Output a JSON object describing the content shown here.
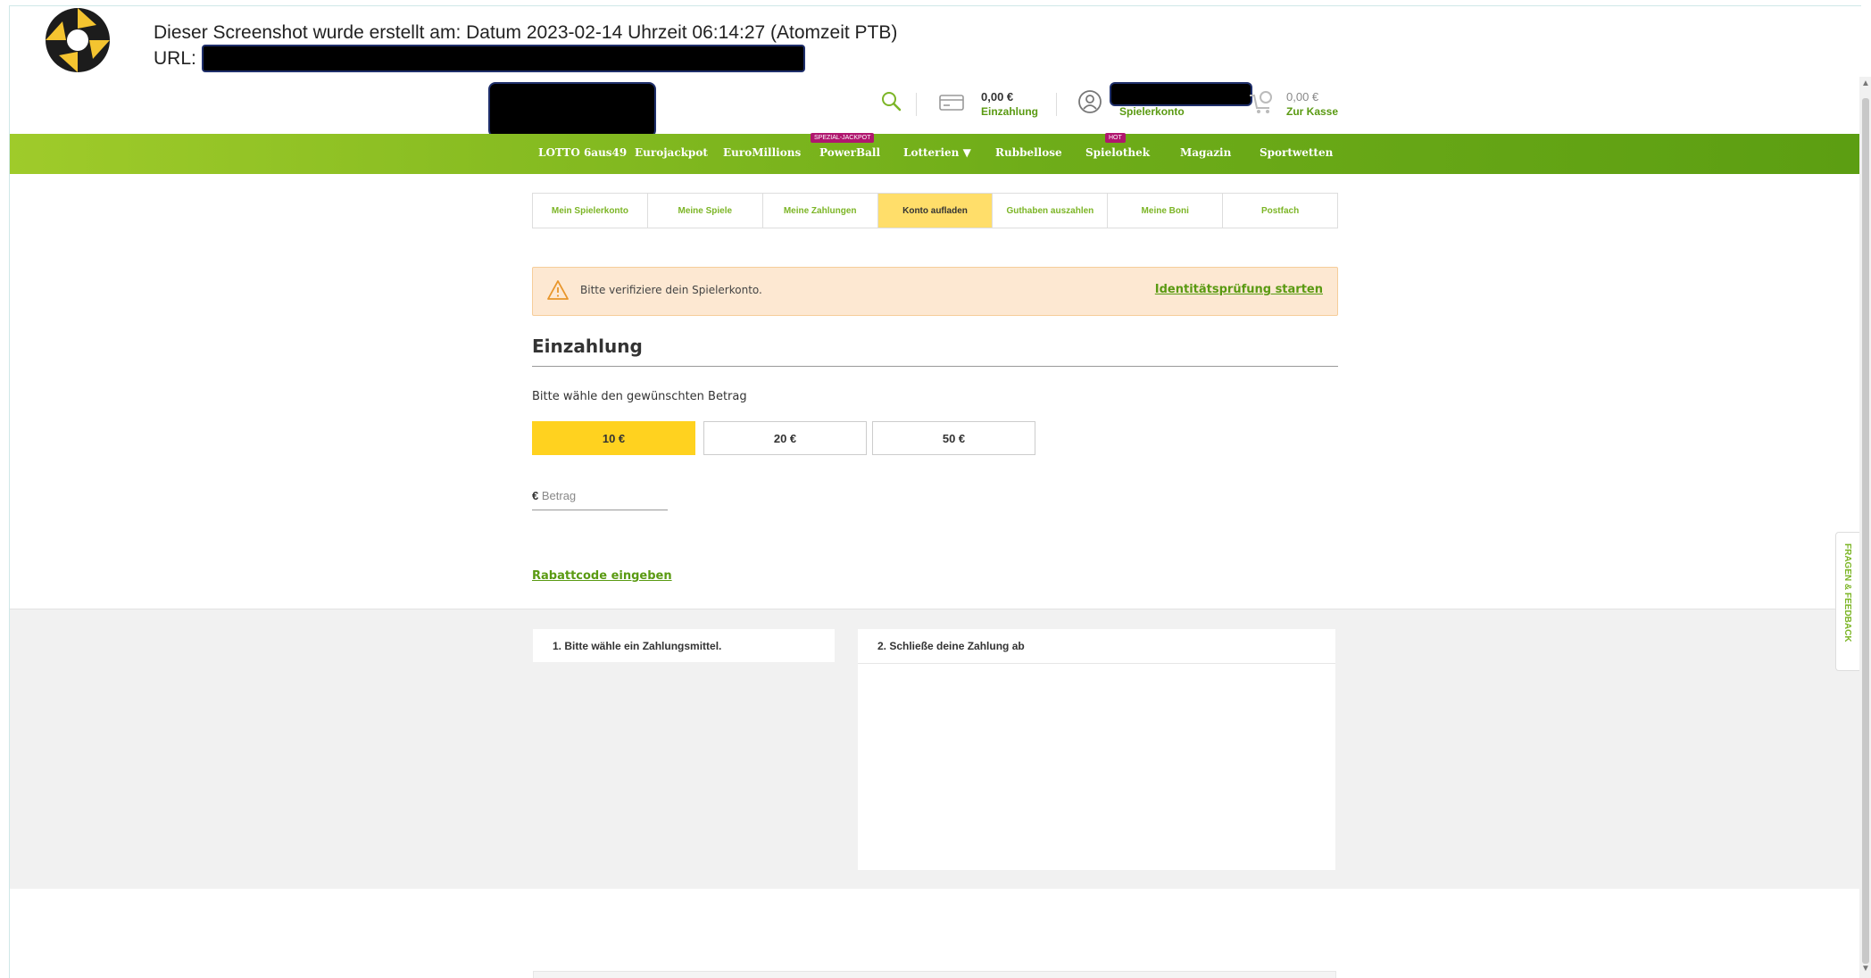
{
  "caption": {
    "line1": "Dieser Screenshot wurde erstellt am: Datum 2023-02-14 Uhrzeit 06:14:27 (Atomzeit PTB)",
    "url_label": "URL:"
  },
  "header": {
    "balance_value": "0,00 €",
    "balance_label": "Einzahlung",
    "account_label": "Spielerkonto",
    "cart_value": "0,00 €",
    "cart_label": "Zur Kasse",
    "icons": [
      "search-icon",
      "card-icon",
      "user-icon",
      "cart-icon"
    ]
  },
  "nav": {
    "items": [
      "LOTTO 6aus49",
      "Eurojackpot",
      "EuroMillions",
      "PowerBall",
      "Lotterien ▼",
      "Rubbellose",
      "Spielothek",
      "Magazin",
      "Sportwetten"
    ],
    "badges": {
      "powerball": "SPEZIAL-JACKPOT",
      "spielothek": "HOT"
    }
  },
  "tabs": [
    "Mein Spielerkonto",
    "Meine Spiele",
    "Meine Zahlungen",
    "Konto aufladen",
    "Guthaben auszahlen",
    "Meine Boni",
    "Postfach"
  ],
  "alert": {
    "text": "Bitte verifiziere dein Spielerkonto.",
    "link": "Identitätsprüfung starten"
  },
  "deposit": {
    "title": "Einzahlung",
    "question": "Bitte wähle den gewünschten Betrag",
    "amounts": [
      "10 €",
      "20 €",
      "50 €"
    ],
    "selected": "10 €",
    "currency": "€",
    "amount_placeholder": "Betrag",
    "promo_link": "Rabattcode eingeben"
  },
  "payment": {
    "step1": "1. Bitte wähle ein Zahlungsmittel.",
    "step2": "2. Schließe deine Zahlung ab"
  },
  "feedback": "FRAGEN & FEEDBACK",
  "colors": {
    "brand_green": "#6fad19",
    "selected_yellow": "#ffd21f",
    "tab_active": "#ffde6a",
    "alert_bg": "#fde8d2"
  }
}
